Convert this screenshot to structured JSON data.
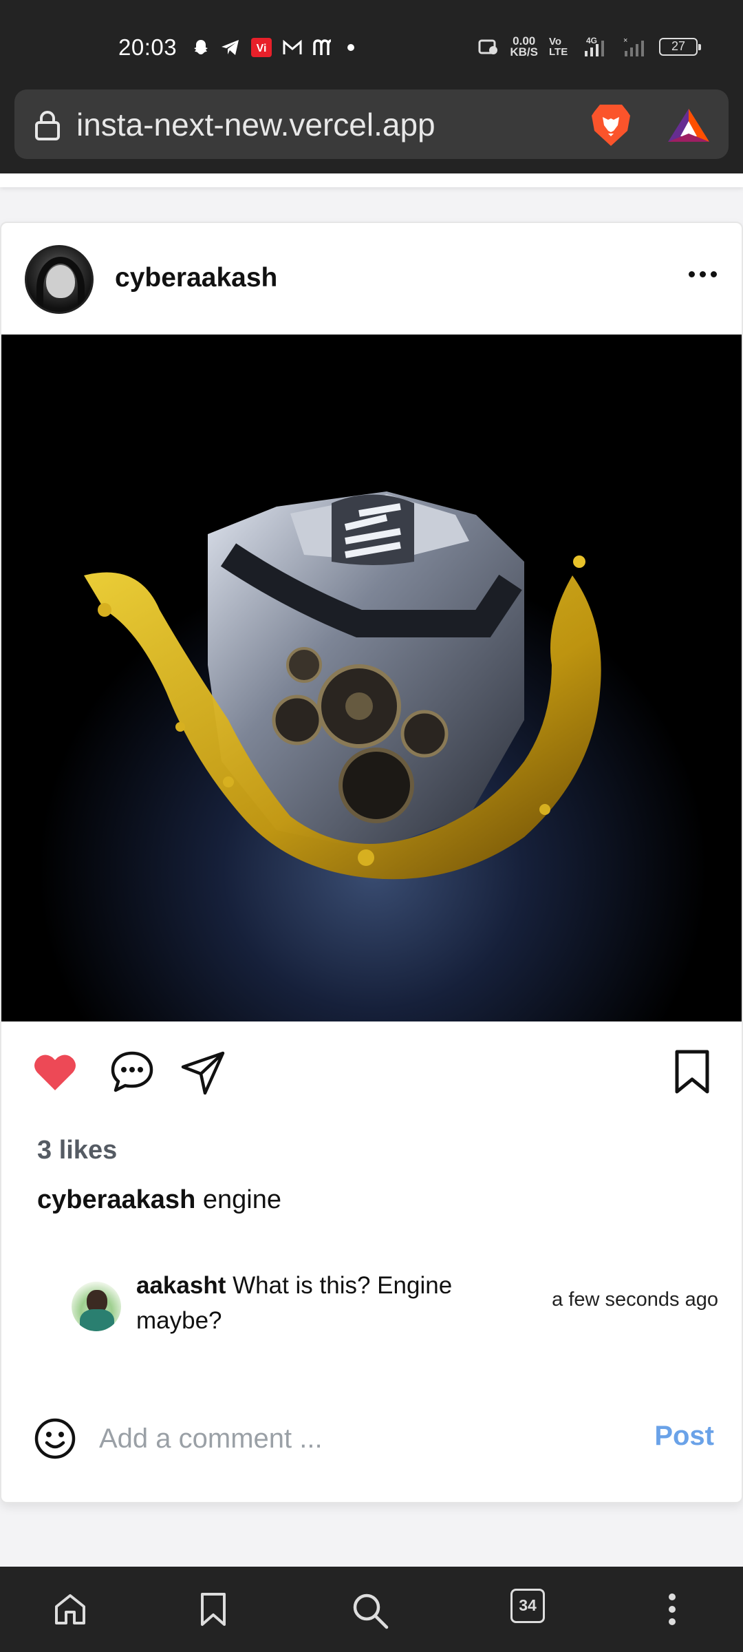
{
  "status_bar": {
    "time": "20:03",
    "net_speed_value": "0.00",
    "net_speed_unit": "KB/S",
    "volte": "Vo LTE",
    "network": "4G",
    "battery": "27"
  },
  "browser": {
    "url": "insta-next-new.vercel.app",
    "tabs_count": "34"
  },
  "post": {
    "username": "cyberaakash",
    "likes": "3 likes",
    "caption_user": "cyberaakash",
    "caption_text": "engine",
    "liked": true,
    "like_color": "#ed4956",
    "comments": [
      {
        "user": "aakasht",
        "text": "What is this? Engine maybe?",
        "time": "a few seconds ago"
      }
    ]
  },
  "add_comment": {
    "placeholder": "Add a comment ...",
    "post_label": "Post",
    "post_color": "#6aa2e8"
  },
  "icons": [
    "lock-icon",
    "brave-lion-icon",
    "brave-rewards-icon",
    "heart-icon",
    "comment-icon",
    "send-icon",
    "bookmark-icon",
    "smiley-icon",
    "home-icon",
    "bookmarks-icon",
    "search-icon",
    "tabs-icon",
    "menu-icon"
  ]
}
